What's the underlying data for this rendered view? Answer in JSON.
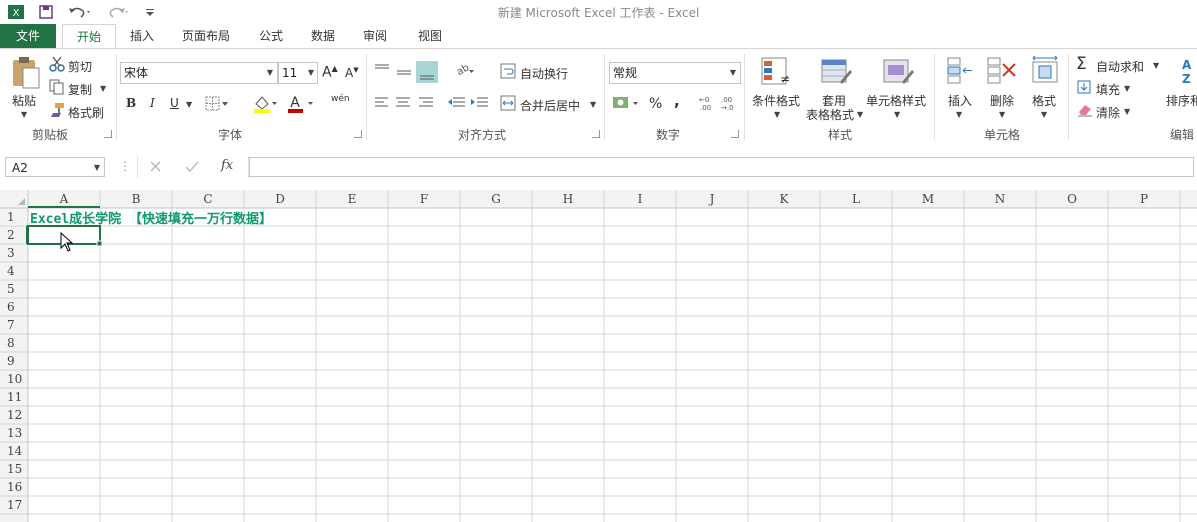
{
  "window": {
    "title": "新建 Microsoft Excel 工作表 - Excel"
  },
  "quick_access": {
    "app_icon": "excel-icon",
    "save_icon": "save-icon",
    "undo_icon": "undo-icon",
    "redo_icon": "redo-icon",
    "customize_icon": "customize-icon"
  },
  "tabs": [
    {
      "label": "文件"
    },
    {
      "label": "开始"
    },
    {
      "label": "插入"
    },
    {
      "label": "页面布局"
    },
    {
      "label": "公式"
    },
    {
      "label": "数据"
    },
    {
      "label": "审阅"
    },
    {
      "label": "视图"
    }
  ],
  "ribbon": {
    "clipboard": {
      "label": "剪贴板",
      "paste": "粘贴",
      "cut": "剪切",
      "copy": "复制",
      "format_painter": "格式刷"
    },
    "font": {
      "label": "字体",
      "font_name": "宋体",
      "font_size": "11",
      "bold": "B",
      "italic": "I",
      "underline": "U",
      "phonetic": "wén"
    },
    "alignment": {
      "label": "对齐方式",
      "wrap_text": "自动换行",
      "merge_center": "合并后居中"
    },
    "number": {
      "label": "数字",
      "format": "常规",
      "percent": "%",
      "comma": ","
    },
    "styles": {
      "label": "样式",
      "conditional": "条件格式",
      "table_line1": "套用",
      "table_line2": "表格格式",
      "cell_styles": "单元格样式"
    },
    "cells": {
      "label": "单元格",
      "insert": "插入",
      "delete": "删除",
      "format": "格式"
    },
    "editing": {
      "label": "编辑",
      "autosum": "自动求和",
      "fill": "填充",
      "clear": "清除",
      "sort": "排序和"
    }
  },
  "formula_bar": {
    "name_box": "A2",
    "fx": "fx",
    "value": ""
  },
  "sheet": {
    "columns": [
      "A",
      "B",
      "C",
      "D",
      "E",
      "F",
      "G",
      "H",
      "I",
      "J",
      "K",
      "L",
      "M",
      "N",
      "O",
      "P"
    ],
    "rows": [
      "1",
      "2",
      "3",
      "4",
      "5",
      "6",
      "7",
      "8",
      "9",
      "10",
      "11",
      "12",
      "13",
      "14",
      "15",
      "16",
      "17"
    ],
    "a1_text": "Excel成长学院  【快速填充一万行数据】",
    "a1_color": "#0e9a6a",
    "active_cell": "A2"
  },
  "colors": {
    "accent": "#217346",
    "grid": "#d4d4d4",
    "header_bg": "#f3f3f3"
  }
}
